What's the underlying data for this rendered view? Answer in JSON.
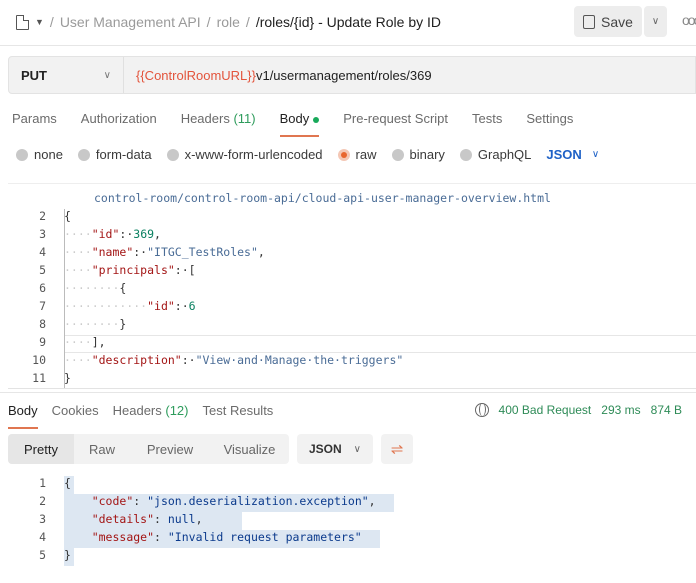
{
  "breadcrumb": {
    "collection": "User Management API",
    "folder": "role",
    "request": "/roles/{id} - Update Role by ID",
    "sep": "/"
  },
  "toolbar": {
    "save_label": "Save",
    "more": "ooo"
  },
  "request": {
    "method": "PUT",
    "url_variable": "{{ControlRoomURL}}",
    "url_path": "v1/usermanagement/roles/369"
  },
  "request_tabs": [
    {
      "label": "Params"
    },
    {
      "label": "Authorization"
    },
    {
      "label": "Headers",
      "count": "(11)"
    },
    {
      "label": "Body",
      "active": true
    },
    {
      "label": "Pre-request Script"
    },
    {
      "label": "Tests"
    },
    {
      "label": "Settings"
    }
  ],
  "body_types": [
    {
      "label": "none"
    },
    {
      "label": "form-data"
    },
    {
      "label": "x-www-form-urlencoded"
    },
    {
      "label": "raw",
      "selected": true
    },
    {
      "label": "binary"
    },
    {
      "label": "GraphQL"
    }
  ],
  "body_format": "JSON",
  "editor": {
    "wrap_line": "control-room/control-room-api/cloud-api-user-manager-overview.html",
    "lines": [
      {
        "n": "2",
        "tokens": [
          {
            "t": "{",
            "c": "p"
          }
        ]
      },
      {
        "n": "3",
        "tokens": [
          {
            "t": "····",
            "c": "ws"
          },
          {
            "t": "\"id\"",
            "c": "k"
          },
          {
            "t": ":·",
            "c": "p"
          },
          {
            "t": "369",
            "c": "n"
          },
          {
            "t": ",",
            "c": "p"
          }
        ]
      },
      {
        "n": "4",
        "tokens": [
          {
            "t": "····",
            "c": "ws"
          },
          {
            "t": "\"name\"",
            "c": "k"
          },
          {
            "t": ":·",
            "c": "p"
          },
          {
            "t": "\"ITGC_TestRoles\"",
            "c": "w"
          },
          {
            "t": ",",
            "c": "p"
          }
        ]
      },
      {
        "n": "5",
        "tokens": [
          {
            "t": "····",
            "c": "ws"
          },
          {
            "t": "\"principals\"",
            "c": "k"
          },
          {
            "t": ":·[",
            "c": "p"
          }
        ]
      },
      {
        "n": "6",
        "tokens": [
          {
            "t": "········",
            "c": "ws"
          },
          {
            "t": "{",
            "c": "p"
          }
        ]
      },
      {
        "n": "7",
        "tokens": [
          {
            "t": "············",
            "c": "ws"
          },
          {
            "t": "\"id\"",
            "c": "k"
          },
          {
            "t": ":·",
            "c": "p"
          },
          {
            "t": "6",
            "c": "n"
          }
        ]
      },
      {
        "n": "8",
        "tokens": [
          {
            "t": "········",
            "c": "ws"
          },
          {
            "t": "}",
            "c": "p"
          }
        ]
      },
      {
        "n": "9",
        "tokens": [
          {
            "t": "····",
            "c": "ws"
          },
          {
            "t": "],",
            "c": "p"
          }
        ]
      },
      {
        "n": "10",
        "tokens": [
          {
            "t": "····",
            "c": "ws"
          },
          {
            "t": "\"description\"",
            "c": "k"
          },
          {
            "t": ":·",
            "c": "p"
          },
          {
            "t": "\"View·and·Manage·the·triggers\"",
            "c": "w"
          }
        ]
      },
      {
        "n": "11",
        "tokens": [
          {
            "t": "}",
            "c": "p"
          }
        ]
      }
    ]
  },
  "response_tabs": [
    {
      "label": "Body",
      "active": true
    },
    {
      "label": "Cookies"
    },
    {
      "label": "Headers",
      "count": "(12)"
    },
    {
      "label": "Test Results"
    }
  ],
  "response_status": {
    "status": "400 Bad Request",
    "time": "293 ms",
    "size": "874 B"
  },
  "response_views": [
    "Pretty",
    "Raw",
    "Preview",
    "Visualize"
  ],
  "response_format": "JSON",
  "response": {
    "lines": [
      {
        "n": "1",
        "tokens": [
          {
            "t": "{",
            "c": "p"
          }
        ]
      },
      {
        "n": "2",
        "tokens": [
          {
            "t": "    ",
            "c": "ws"
          },
          {
            "t": "\"code\"",
            "c": "k"
          },
          {
            "t": ": ",
            "c": "p"
          },
          {
            "t": "\"json.deserialization.exception\"",
            "c": "s"
          },
          {
            "t": ",",
            "c": "p"
          }
        ]
      },
      {
        "n": "3",
        "tokens": [
          {
            "t": "    ",
            "c": "ws"
          },
          {
            "t": "\"details\"",
            "c": "k"
          },
          {
            "t": ": ",
            "c": "p"
          },
          {
            "t": "null",
            "c": "s"
          },
          {
            "t": ",",
            "c": "p"
          }
        ]
      },
      {
        "n": "4",
        "tokens": [
          {
            "t": "    ",
            "c": "ws"
          },
          {
            "t": "\"message\"",
            "c": "k"
          },
          {
            "t": ": ",
            "c": "p"
          },
          {
            "t": "\"Invalid request parameters\"",
            "c": "s"
          }
        ]
      },
      {
        "n": "5",
        "tokens": [
          {
            "t": "}",
            "c": "p"
          }
        ]
      }
    ]
  },
  "colors": {
    "accent": "#e07650",
    "success": "#2e8b57",
    "link": "#1e61c6",
    "variable": "#e3543c"
  }
}
